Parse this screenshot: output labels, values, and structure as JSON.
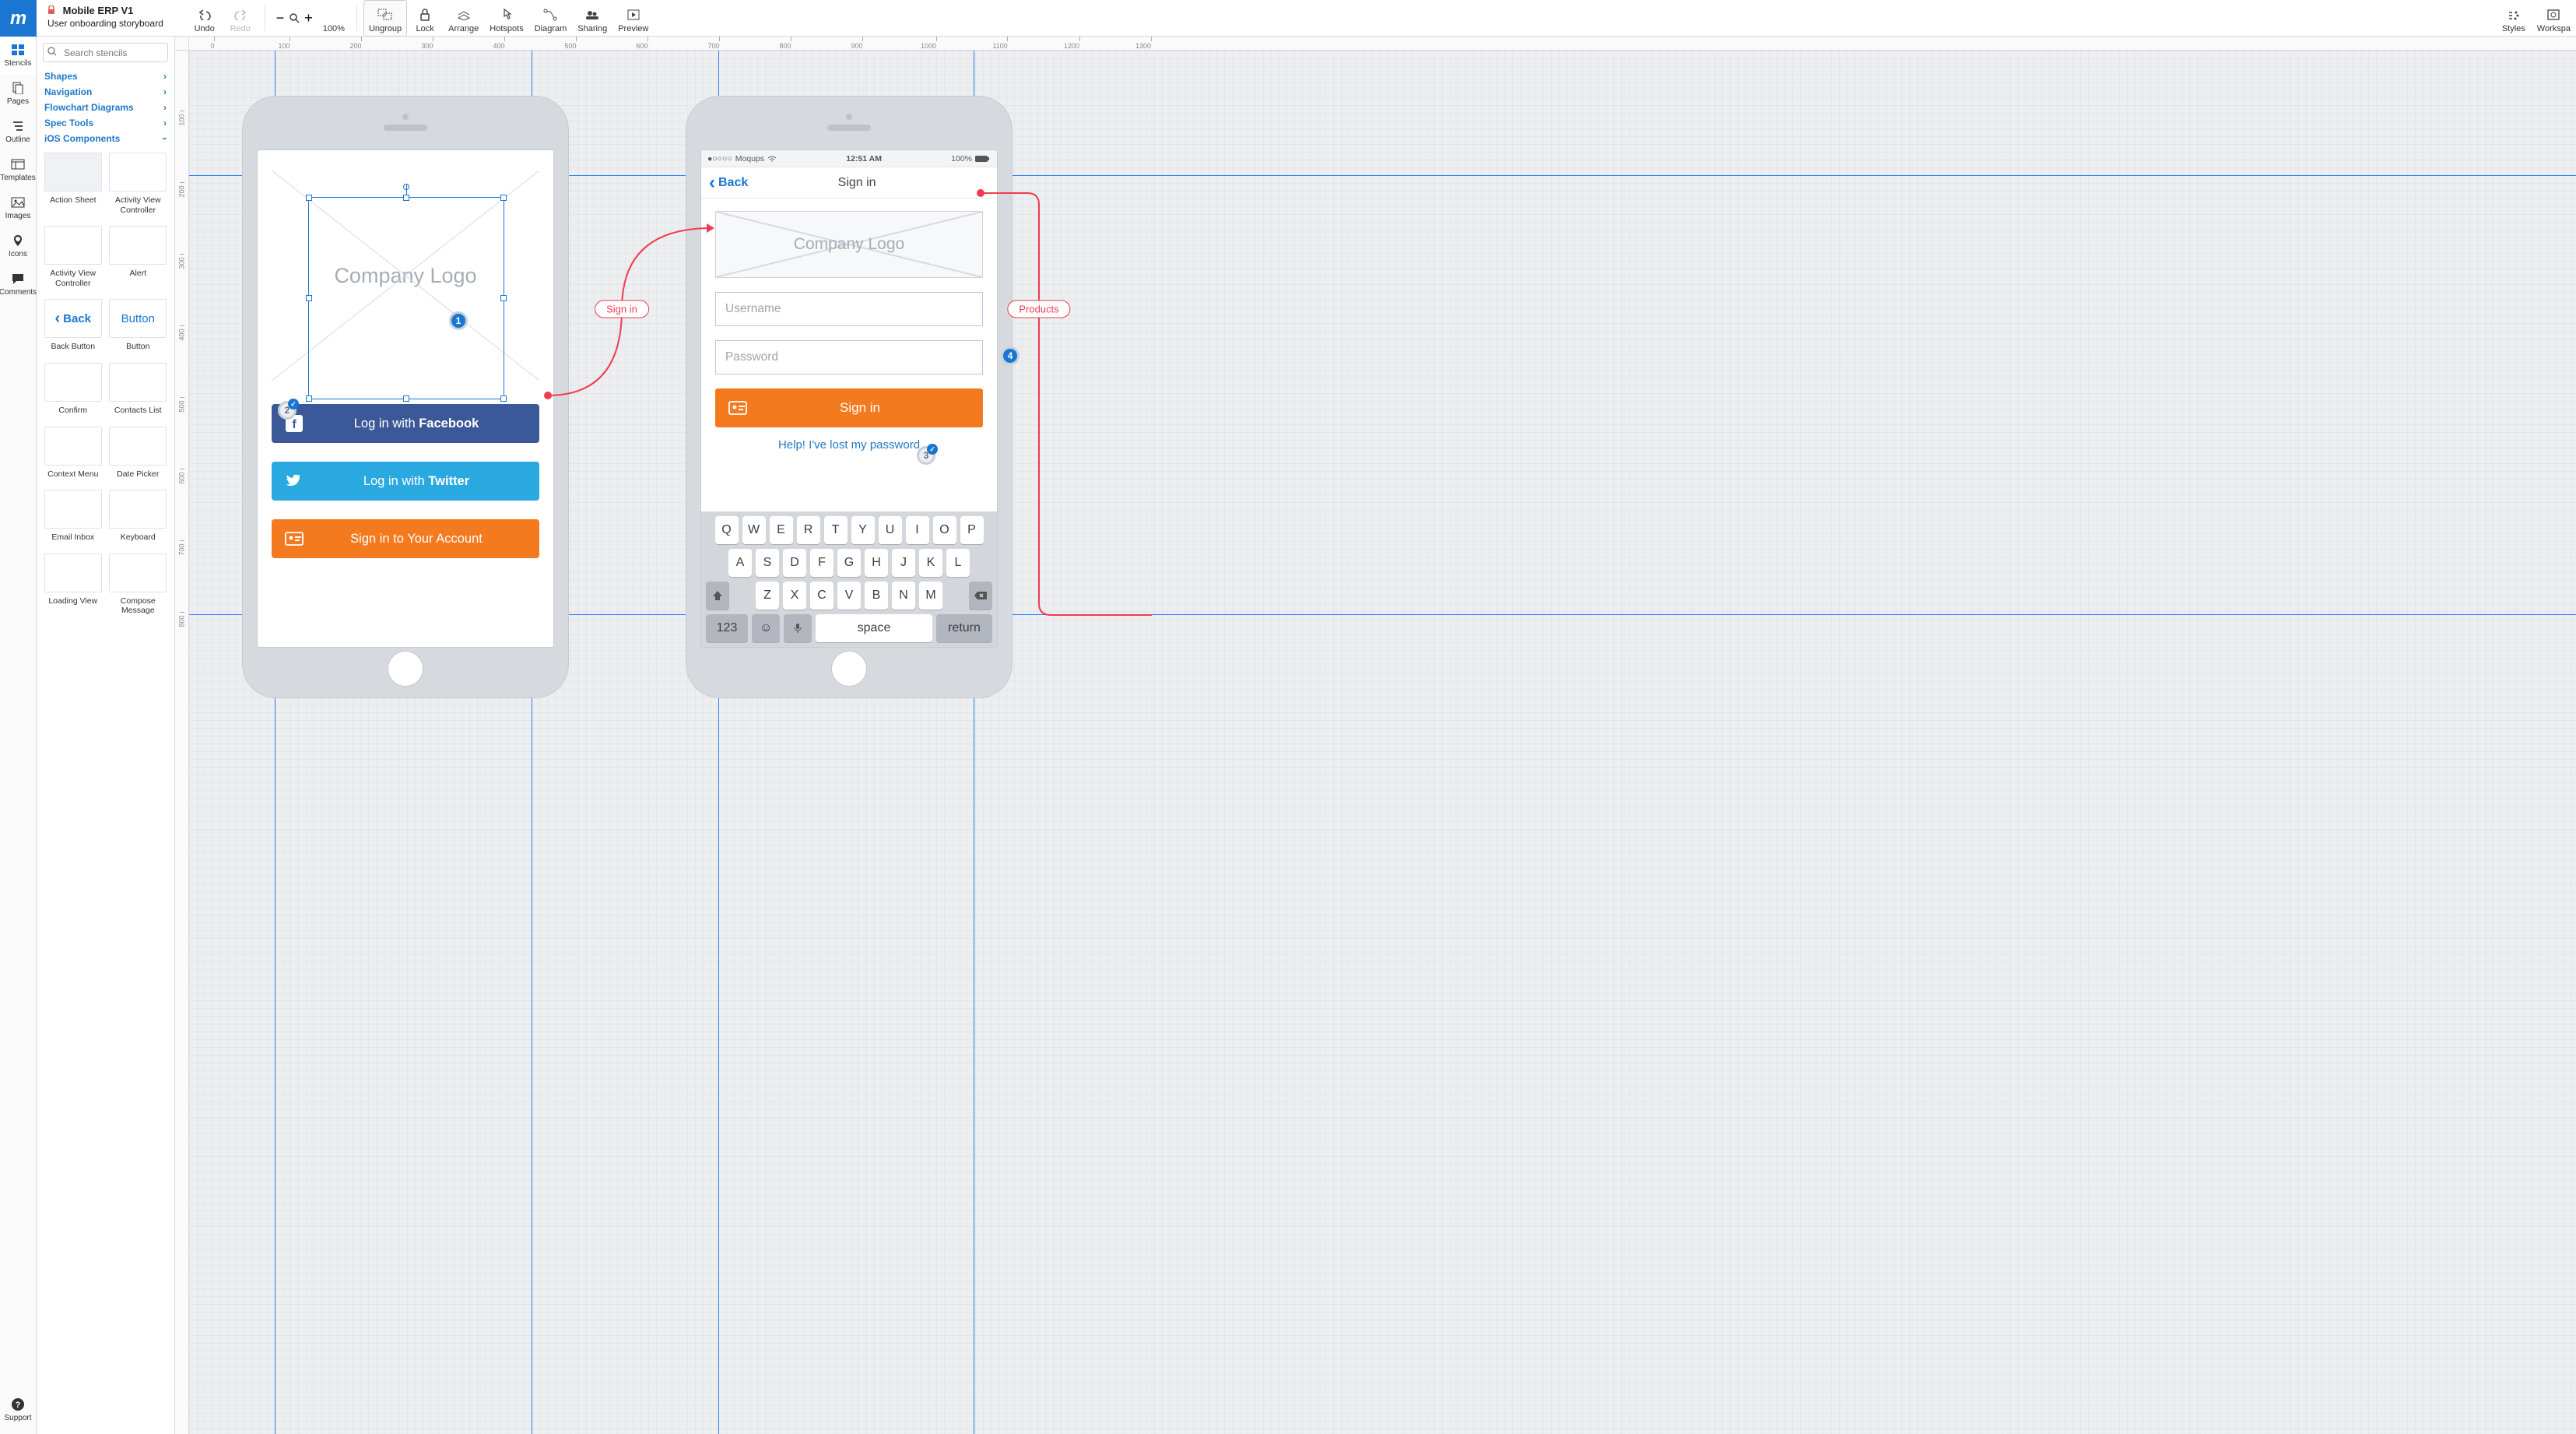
{
  "header": {
    "logo_letter": "m",
    "project_name": "Mobile ERP V1",
    "project_subtitle": "User onboarding storyboard",
    "zoom_label": "100%"
  },
  "toolbar": {
    "undo": "Undo",
    "redo": "Redo",
    "zoom": "100%",
    "ungroup": "Ungroup",
    "lock": "Lock",
    "arrange": "Arrange",
    "hotspots": "Hotspots",
    "diagram": "Diagram",
    "sharing": "Sharing",
    "preview": "Preview",
    "styles": "Styles",
    "workspace": "Workspa"
  },
  "rail": {
    "stencils": "Stencils",
    "pages": "Pages",
    "outline": "Outline",
    "templates": "Templates",
    "images": "Images",
    "icons": "Icons",
    "comments": "Comments",
    "support": "Support"
  },
  "panel": {
    "search_placeholder": "Search stencils",
    "categories": [
      "Shapes",
      "Navigation",
      "Flowchart Diagrams",
      "Spec Tools",
      "iOS Components"
    ],
    "stencils": [
      {
        "label": "Action Sheet"
      },
      {
        "label": "Activity View Controller"
      },
      {
        "label": "Activity View Controller"
      },
      {
        "label": "Alert"
      },
      {
        "label": "Back Button"
      },
      {
        "label": "Button"
      },
      {
        "label": "Confirm"
      },
      {
        "label": "Contacts List"
      },
      {
        "label": "Context Menu"
      },
      {
        "label": "Date Picker"
      },
      {
        "label": "Email Inbox"
      },
      {
        "label": "Keyboard"
      },
      {
        "label": "Loading View"
      },
      {
        "label": "Compose Message"
      }
    ],
    "thumb_back_text": "Back",
    "thumb_button_text": "Button"
  },
  "ruler_h": [
    0,
    100,
    200,
    300,
    400,
    500,
    600,
    700,
    800,
    900,
    1000,
    1100,
    1200,
    1300
  ],
  "ruler_v": [
    100,
    200,
    300,
    400,
    500,
    600,
    700,
    800
  ],
  "guides": {
    "v": [
      110,
      440,
      680,
      1008
    ],
    "h": [
      136,
      720
    ]
  },
  "screens": {
    "one": {
      "logo_text": "Company Logo",
      "fb_prefix": "Log in with ",
      "fb_bold": "Facebook",
      "tw_prefix": "Log in with ",
      "tw_bold": "Twitter",
      "signin": "Sign in to Your Account"
    },
    "two": {
      "status_carrier": "Moqups",
      "status_time": "12:51 AM",
      "status_batt": "100%",
      "nav_back": "Back",
      "nav_title": "Sign in",
      "logo_text": "Company Logo",
      "username_placeholder": "Username",
      "password_placeholder": "Password",
      "signin_label": "Sign in",
      "help_link": "Help! I've lost my password",
      "keys_r1": [
        "Q",
        "W",
        "E",
        "R",
        "T",
        "Y",
        "U",
        "I",
        "O",
        "P"
      ],
      "keys_r2": [
        "A",
        "S",
        "D",
        "F",
        "G",
        "H",
        "J",
        "K",
        "L"
      ],
      "keys_r3": [
        "Z",
        "X",
        "C",
        "V",
        "B",
        "N",
        "M"
      ],
      "key_123": "123",
      "key_space": "space",
      "key_return": "return"
    }
  },
  "connectors": {
    "signin_label": "Sign in",
    "products_label": "Products"
  },
  "markers": {
    "m1": "1",
    "m2": "2",
    "m3": "3",
    "m4": "4"
  }
}
